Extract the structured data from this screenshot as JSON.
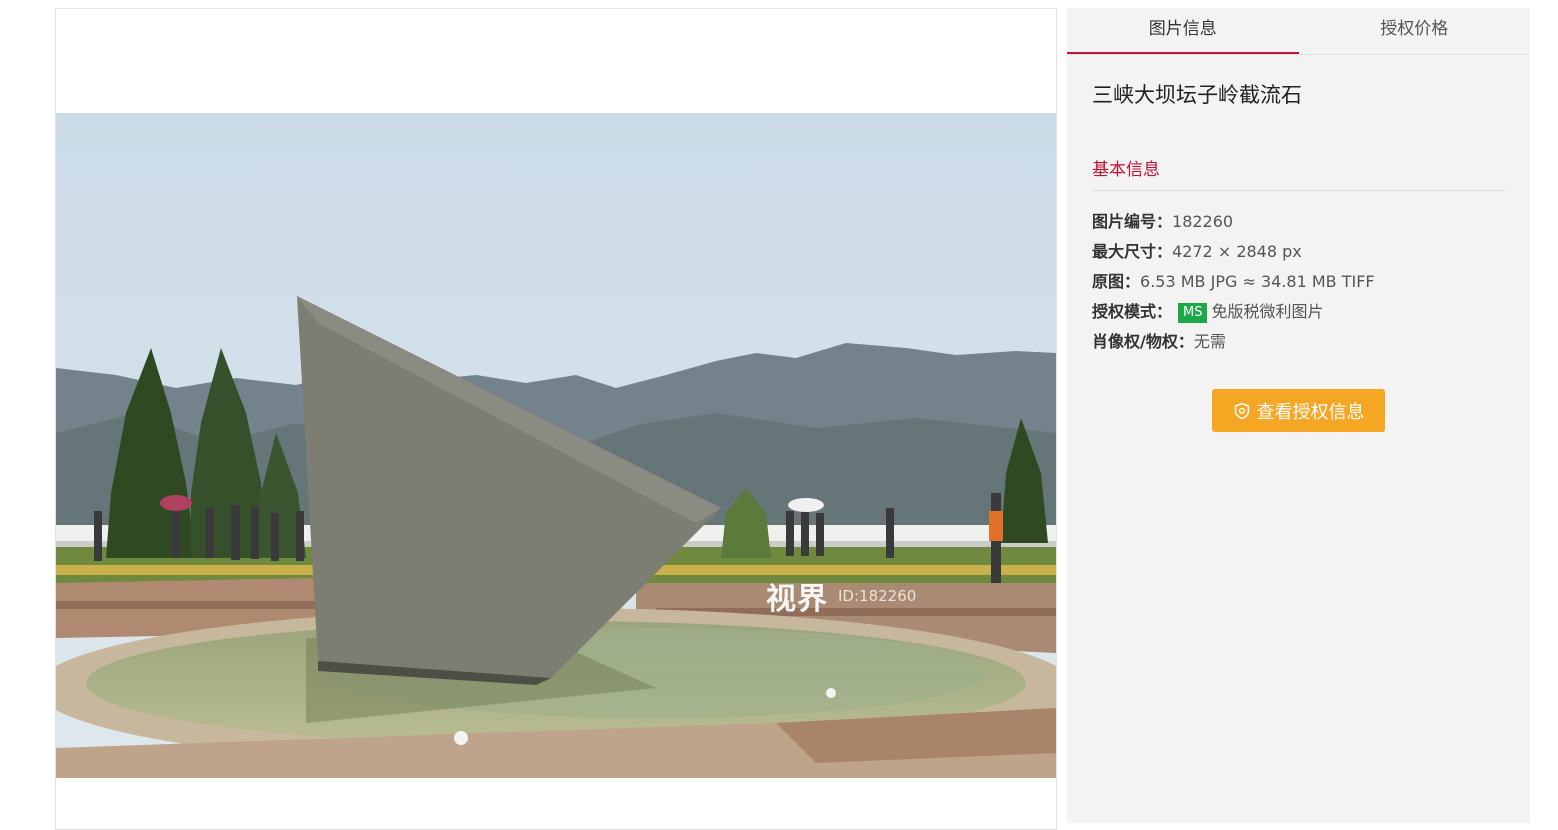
{
  "tabs": [
    {
      "label": "图片信息",
      "active": true
    },
    {
      "label": "授权价格",
      "active": false
    }
  ],
  "photo": {
    "title": "三峡大坝坛子岭截流石",
    "watermark_logo": "视界",
    "watermark_id": "ID:182260"
  },
  "basic_info": {
    "heading": "基本信息",
    "image_id_label": "图片编号：",
    "image_id": "182260",
    "max_size_label": "最大尺寸：",
    "max_size": "4272 × 2848 px",
    "original_label": "原图：",
    "original": "6.53 MB JPG ≈ 34.81 MB TIFF",
    "license_mode_label": "授权模式：",
    "license_badge": "MS",
    "license_mode": "免版税微利图片",
    "portrait_label": "肖像权/物权：",
    "portrait": "无需"
  },
  "license_button": {
    "label": "查看授权信息",
    "icon": "shield-icon"
  },
  "colors": {
    "accent": "#c8102e",
    "button": "#f5a623",
    "badge": "#1da84a",
    "panel": "#f3f3f3"
  }
}
